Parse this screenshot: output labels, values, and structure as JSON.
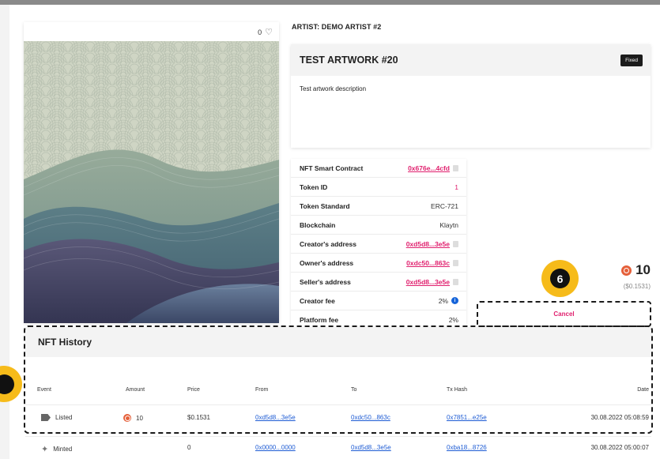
{
  "artwork": {
    "likes": "0"
  },
  "artist_label": "ARTIST: DEMO ARTIST #2",
  "title": "TEST ARTWORK #20",
  "sale_type": "Fixed",
  "description": "Test artwork description",
  "info": [
    {
      "label": "NFT Smart Contract",
      "value": "0x676e...4cfd"
    },
    {
      "label": "Token ID",
      "value": "1"
    },
    {
      "label": "Token Standard",
      "value": "ERC-721"
    },
    {
      "label": "Blockchain",
      "value": "Klaytn"
    },
    {
      "label": "Creator's address",
      "value": "0xd5d8...3e5e"
    },
    {
      "label": "Owner's address",
      "value": "0xdc50...863c"
    },
    {
      "label": "Seller's address",
      "value": "0xd5d8...3e5e"
    },
    {
      "label": "Creator fee",
      "value": "2%"
    },
    {
      "label": "Platform fee",
      "value": "2%"
    }
  ],
  "price": {
    "amount": "10",
    "usd": "($0.1531)"
  },
  "step_badge": "6",
  "cancel_label": "Cancel",
  "history": {
    "title": "NFT History",
    "columns": [
      "Event",
      "Amount",
      "Price",
      "From",
      "To",
      "Tx Hash",
      "Date"
    ],
    "rows": [
      {
        "event": "Listed",
        "amount": "10",
        "price": "$0.1531",
        "from": "0xd5d8...3e5e",
        "to": "0xdc50...863c",
        "tx": "0x7851...e25e",
        "date": "30.08.2022 05:08:59"
      },
      {
        "event": "Minted",
        "amount": "",
        "price": "0",
        "from": "0x0000...0000",
        "to": "0xd5d8...3e5e",
        "tx": "0xba18...8726",
        "date": "30.08.2022 05:00:07"
      }
    ]
  },
  "colors": {
    "accent": "#e0206e",
    "link": "#1e5cd4",
    "highlight": "#f6bb1a"
  }
}
